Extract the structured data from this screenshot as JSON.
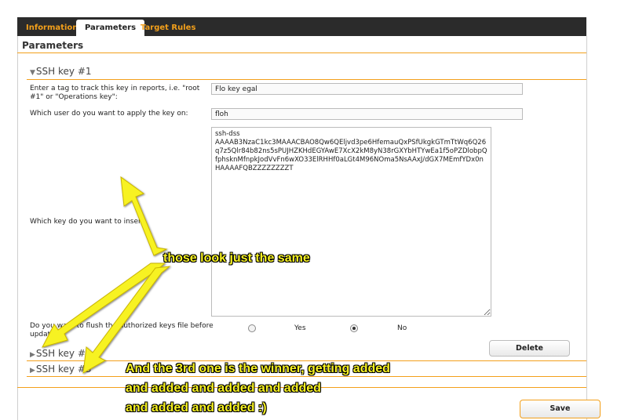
{
  "tabs": [
    {
      "label": "Information",
      "active": false
    },
    {
      "label": "Parameters",
      "active": true
    },
    {
      "label": "Target Rules",
      "active": false
    }
  ],
  "panel": {
    "title": "Parameters"
  },
  "ssh_keys": [
    {
      "title": "SSH key #1",
      "expanded": true
    },
    {
      "title": "SSH key #2",
      "expanded": false
    },
    {
      "title": "SSH key #3",
      "expanded": false
    }
  ],
  "form": {
    "tag_label": "Enter a tag to track this key in reports, i.e. \"root #1\" or \"Operations key\":",
    "tag_value": "Flo key egal",
    "user_label": "Which user do you want to apply the key on:",
    "user_value": "floh",
    "key_label": "Which key do you want to insert:",
    "key_value": "ssh-dss\nAAAAB3NzaC1kc3MAAACBAO8Qw6QEljvd3pe6HfemauQxPSfUkgkGTmTtWq6Q26q7z5Qlr84b82ns5sPUJHZKHdEGYAwE7XcX2kM8yN38rGXYbHTYwEa1f5oPZDlobpQfphsknMfnpkJodVvFn6wXO33ElRHHf0aLGt4M96NOma5NsAAxJ/dGX7MEmfYDx0nHAAAAFQBZZZZZZZZT",
    "flush_label": "Do you want to flush the authorized keys file before update?",
    "flush_label_line1": "Do you want to flush the authorized keys file before",
    "flush_label_line2": "update?",
    "radio_yes": "Yes",
    "radio_no": "No",
    "selected": "No"
  },
  "buttons": {
    "delete": "Delete",
    "save": "Save"
  },
  "annotations": {
    "note1": "those look just the same",
    "note2_line1": "And the 3rd one is the winner, getting added",
    "note2_line2": "and added and added and added",
    "note2_line3": "and added and added :)"
  },
  "colors": {
    "accent": "#f3a01b",
    "tabbar": "#2b2b2b",
    "annotation": "#f7f222"
  }
}
